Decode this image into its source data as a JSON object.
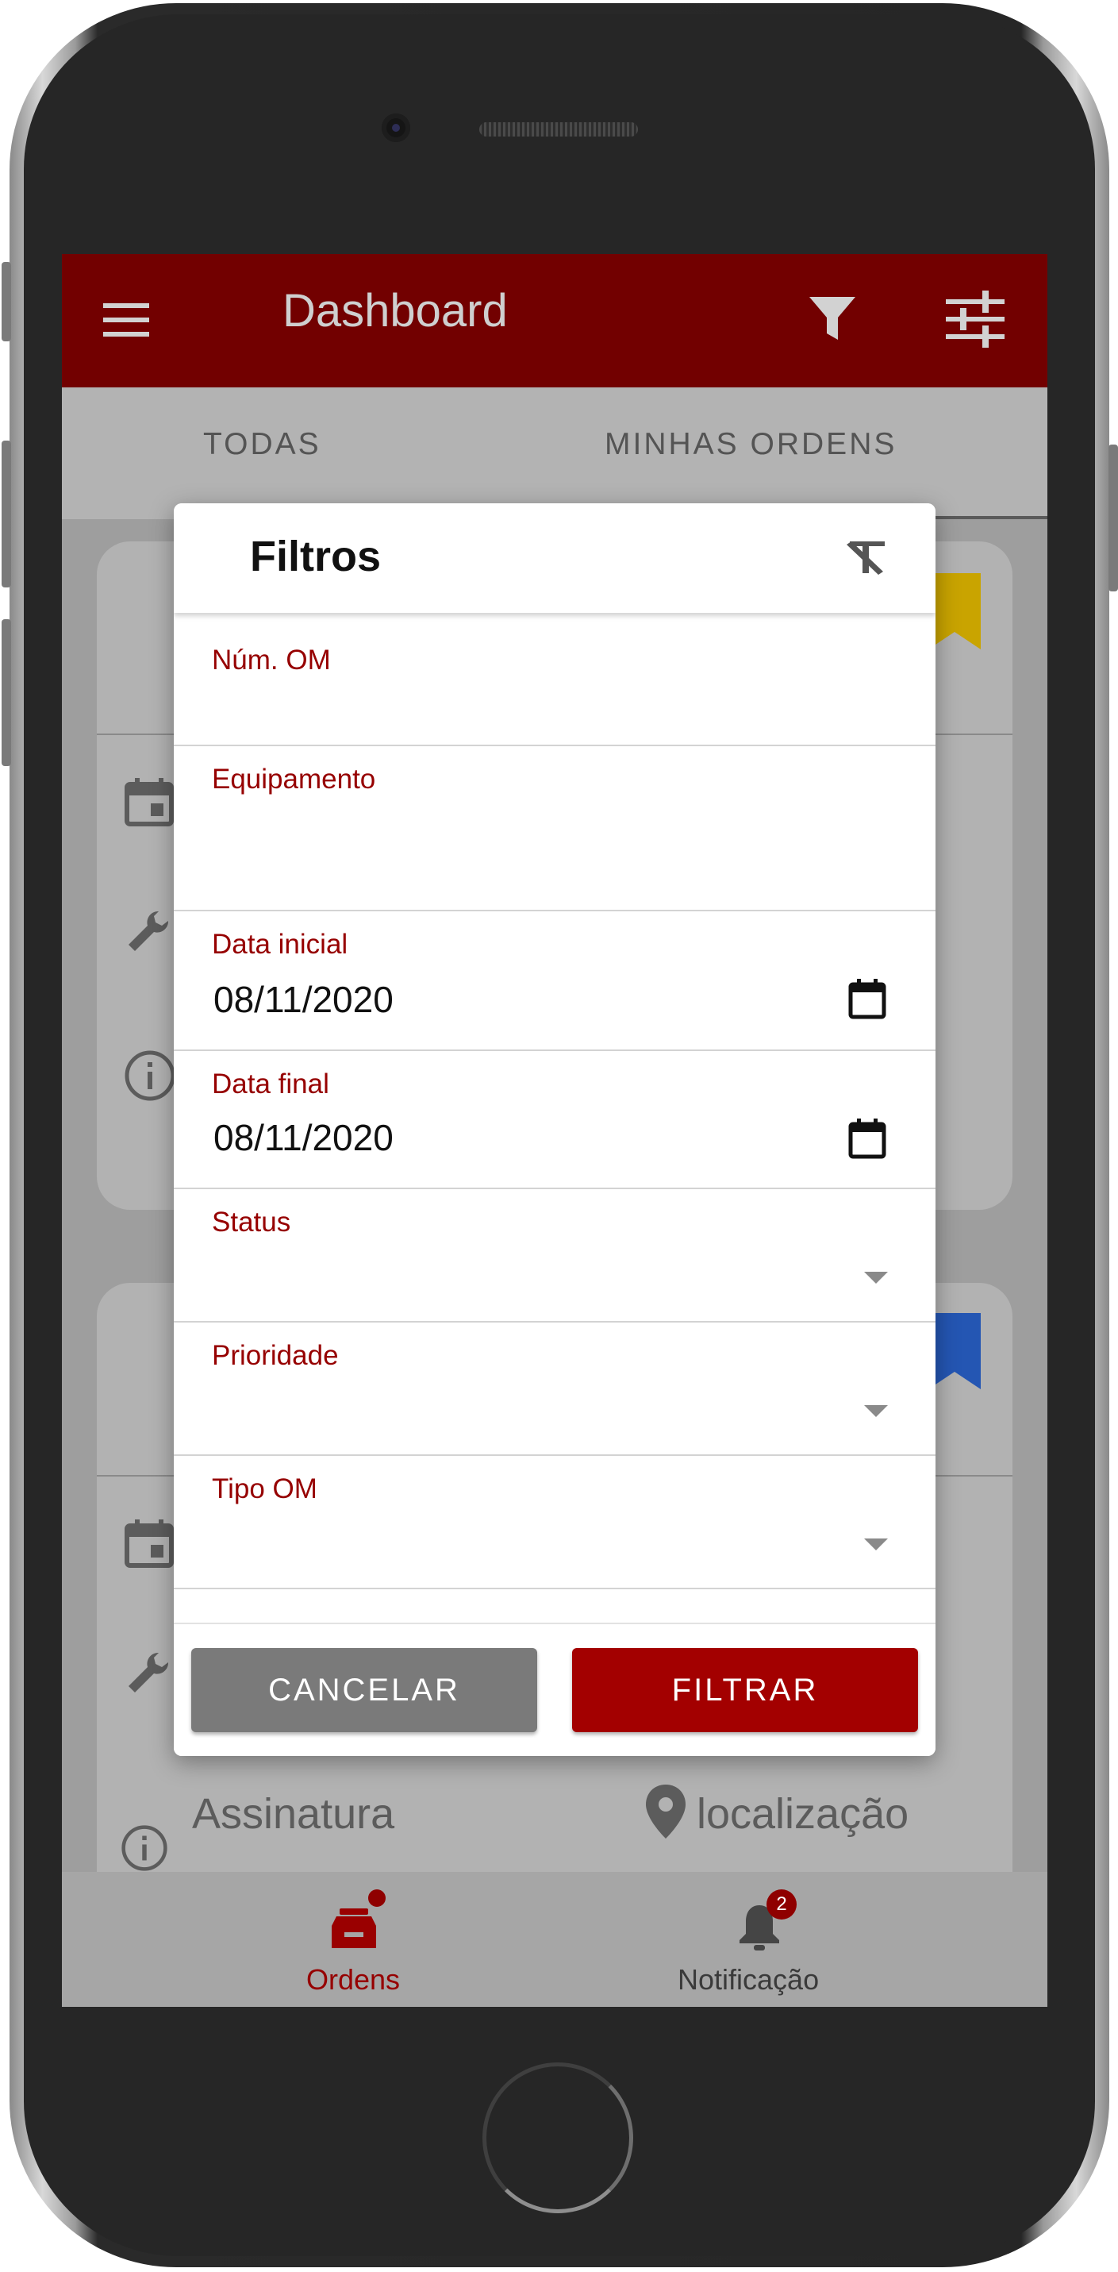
{
  "appbar": {
    "title": "Dashboard"
  },
  "tabs": [
    {
      "label": "TODAS"
    },
    {
      "label": "MINHAS ORDENS"
    }
  ],
  "background": {
    "card2_signature_text": "Assinatura",
    "card2_location_text": "localização"
  },
  "filter_dialog": {
    "title": "Filtros",
    "fields": {
      "num_om": {
        "label": "Núm. OM",
        "value": ""
      },
      "equipamento": {
        "label": "Equipamento",
        "value": ""
      },
      "data_inicial": {
        "label": "Data inicial",
        "value": "08/11/2020"
      },
      "data_final": {
        "label": "Data final",
        "value": "08/11/2020"
      },
      "status": {
        "label": "Status",
        "value": ""
      },
      "prioridade": {
        "label": "Prioridade",
        "value": ""
      },
      "tipo_om": {
        "label": "Tipo OM",
        "value": ""
      }
    },
    "cancel_label": "CANCELAR",
    "filter_label": "FILTRAR"
  },
  "bottom_nav": {
    "orders_label": "Ordens",
    "notifications_label": "Notificação",
    "notifications_badge": "2"
  },
  "colors": {
    "primary": "#720000",
    "accent": "#a30000",
    "label": "#960000",
    "cancel_button": "#7a7a7a",
    "bookmark_yellow": "#c9a400",
    "bookmark_blue": "#2456b3"
  },
  "icons": [
    "menu-icon",
    "filter-icon",
    "tune-icon",
    "clear-filter-icon",
    "calendar-icon",
    "wrench-icon",
    "info-icon",
    "location-icon",
    "inbox-icon",
    "bell-icon",
    "chevron-down-icon"
  ]
}
